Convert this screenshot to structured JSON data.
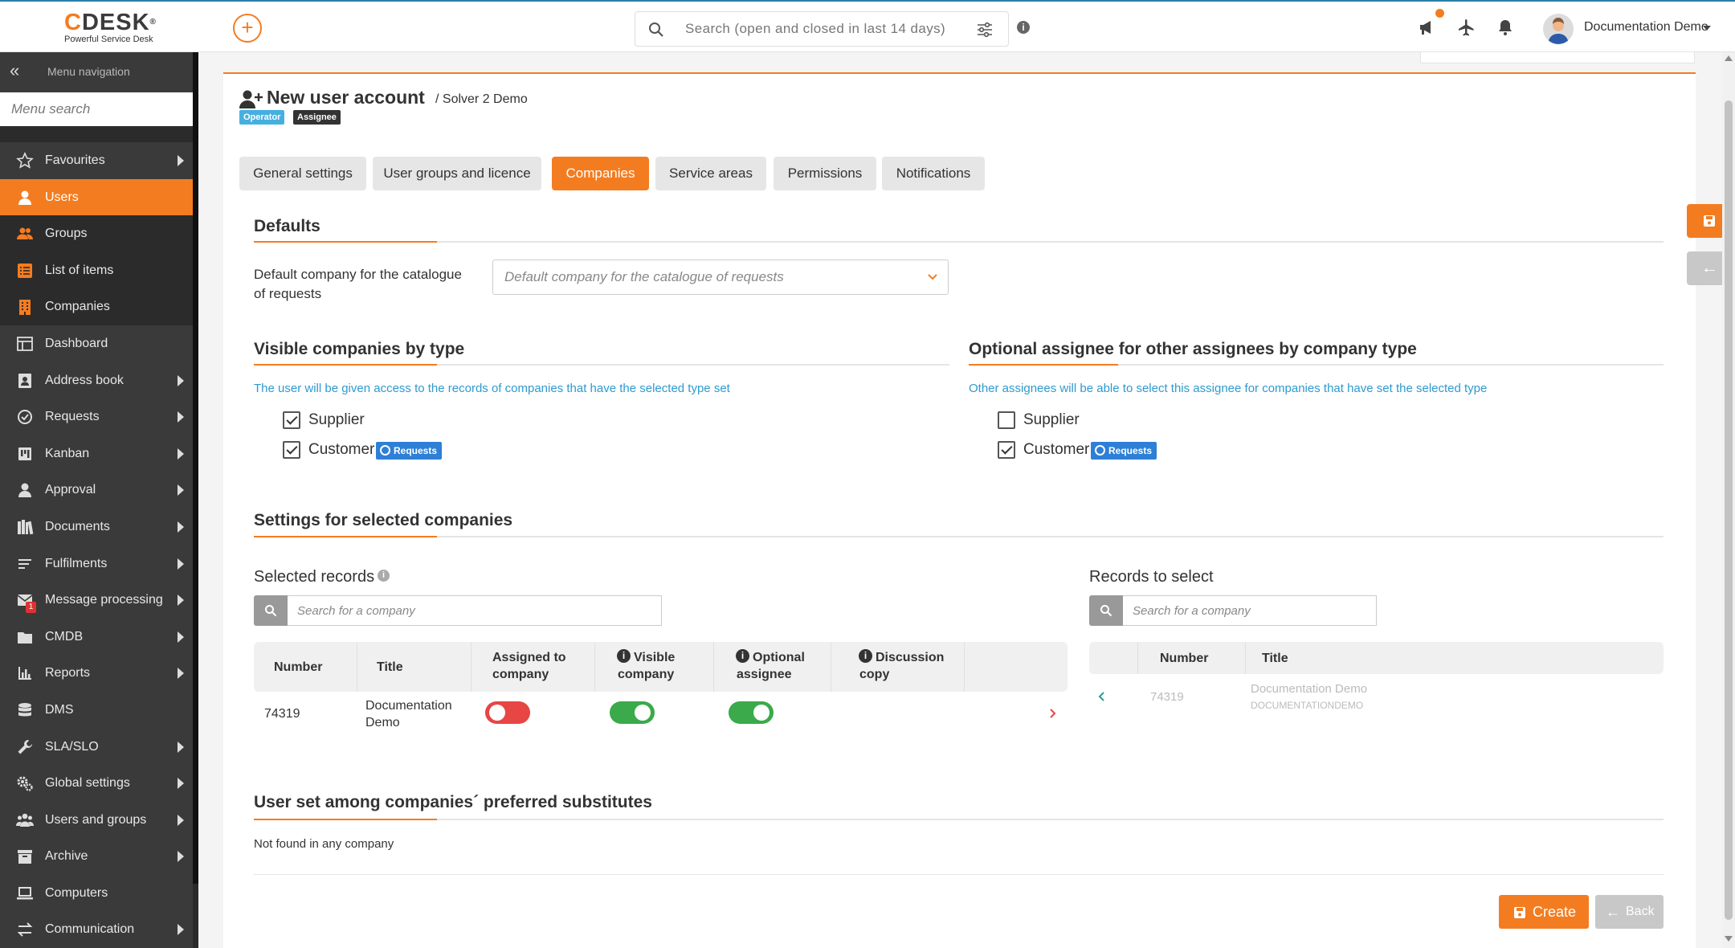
{
  "header": {
    "logo_text": "CDESK",
    "logo_subtitle": "Powerful Service Desk",
    "search_placeholder": "Search (open and closed in last 14 days)",
    "user_name": "Documentation Demo"
  },
  "sidebar": {
    "nav_label": "Menu navigation",
    "search_placeholder": "Menu search",
    "items": [
      {
        "label": "Favourites",
        "icon": "star-icon",
        "submenu": true
      },
      {
        "label": "Users",
        "icon": "user-icon",
        "submenu": false,
        "active": true
      },
      {
        "label": "Groups",
        "icon": "group-icon",
        "submenu": false
      },
      {
        "label": "List of items",
        "icon": "list-icon",
        "submenu": false
      },
      {
        "label": "Companies",
        "icon": "building-icon",
        "submenu": false
      },
      {
        "label": "Dashboard",
        "icon": "dashboard-icon",
        "submenu": false
      },
      {
        "label": "Address book",
        "icon": "address-book-icon",
        "submenu": true
      },
      {
        "label": "Requests",
        "icon": "requests-icon",
        "submenu": true
      },
      {
        "label": "Kanban",
        "icon": "kanban-icon",
        "submenu": true
      },
      {
        "label": "Approval",
        "icon": "approval-icon",
        "submenu": true
      },
      {
        "label": "Documents",
        "icon": "documents-icon",
        "submenu": true
      },
      {
        "label": "Fulfilments",
        "icon": "fulfilments-icon",
        "submenu": true
      },
      {
        "label": "Message processing",
        "icon": "mail-icon",
        "submenu": true,
        "badge": "1"
      },
      {
        "label": "CMDB",
        "icon": "folder-icon",
        "submenu": true
      },
      {
        "label": "Reports",
        "icon": "reports-icon",
        "submenu": true
      },
      {
        "label": "DMS",
        "icon": "database-icon",
        "submenu": false
      },
      {
        "label": "SLA/SLO",
        "icon": "wrench-icon",
        "submenu": true
      },
      {
        "label": "Global settings",
        "icon": "gears-icon",
        "submenu": true
      },
      {
        "label": "Users and groups",
        "icon": "users-icon",
        "submenu": true
      },
      {
        "label": "Archive",
        "icon": "archive-icon",
        "submenu": true
      },
      {
        "label": "Computers",
        "icon": "laptop-icon",
        "submenu": false
      },
      {
        "label": "Communication",
        "icon": "exchange-icon",
        "submenu": true
      }
    ]
  },
  "page": {
    "title": "New user account",
    "subtitle": "/ Solver 2 Demo",
    "tags": [
      "Operator",
      "Assignee"
    ],
    "tabs": [
      "General settings",
      "User groups and licence",
      "Companies",
      "Service areas",
      "Permissions",
      "Notifications"
    ],
    "active_tab": "Companies"
  },
  "defaults": {
    "heading": "Defaults",
    "field_label": "Default company for the catalogue of requests",
    "select_placeholder": "Default company for the catalogue of requests"
  },
  "visible_companies": {
    "heading": "Visible companies by type",
    "hint": "The user will be given access to the records of companies that have the selected type set",
    "options": [
      {
        "label": "Supplier",
        "checked": true
      },
      {
        "label": "Customer",
        "checked": true,
        "badge": "Requests"
      }
    ]
  },
  "optional_assignee": {
    "heading": "Optional assignee for other assignees by company type",
    "hint": "Other assignees will be able to select this assignee for companies that have set the selected type",
    "options": [
      {
        "label": "Supplier",
        "checked": false
      },
      {
        "label": "Customer",
        "checked": true,
        "badge": "Requests"
      }
    ]
  },
  "selected_settings": {
    "heading": "Settings for selected companies",
    "selected": {
      "heading": "Selected records",
      "search_placeholder": "Search for a company",
      "columns": [
        "Number",
        "Title",
        "Assigned to company",
        "Visible company",
        "Optional assignee",
        "Discussion copy"
      ],
      "rows": [
        {
          "number": "74319",
          "title": "Documentation Demo",
          "assigned": false,
          "visible": true,
          "optional": true
        }
      ]
    },
    "to_select": {
      "heading": "Records to select",
      "search_placeholder": "Search for a company",
      "columns": [
        "Number",
        "Title"
      ],
      "rows": [
        {
          "number": "74319",
          "title": "Documentation Demo",
          "code": "DOCUMENTATIONDEMO"
        }
      ]
    }
  },
  "substitutes": {
    "heading": "User set among companies´ preferred substitutes",
    "text": "Not found in any company"
  },
  "actions": {
    "create": "Create",
    "back": "Back"
  },
  "colors": {
    "accent": "#f47c20",
    "sidebar_bg": "#2b2b2b",
    "hint": "#2e9ad0",
    "toggle_on": "#3aaa4a",
    "toggle_off": "#e84545",
    "tag_operator": "#45b0e0",
    "tag_assignee": "#333333",
    "badge_requests": "#2e7fd6"
  }
}
